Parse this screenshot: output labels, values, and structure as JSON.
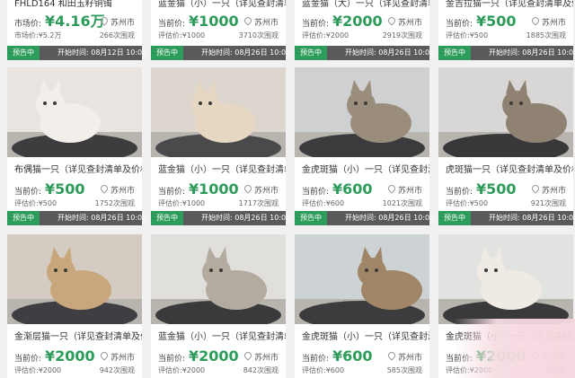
{
  "grid": {
    "top_row": [
      {
        "title": "FHLD164 和田玉籽铜镯",
        "price_label": "市场价:",
        "price": "¥4.16万",
        "location": "苏州市",
        "evaluation": "市场价:¥5.2万",
        "views": "266次围观"
      },
      {
        "title": "蓝金猫（小）一只（详见查封清单及价格通知…",
        "price_label": "当前价:",
        "price": "¥1000",
        "location": "苏州市",
        "evaluation": "评估价:¥1000",
        "views": "3710次围观",
        "status": "预告中",
        "start_time": "开始时间: 08月26日 10:00"
      },
      {
        "title": "蓝金猫（大）一只（详见查封清单及价格通知…",
        "price_label": "当前价:",
        "price": "¥2000",
        "location": "苏州市",
        "evaluation": "评估价:¥2000",
        "views": "2919次围观",
        "status": "预告中",
        "start_time": "开始时间: 08月26日 10:00"
      },
      {
        "title": "金吉拉猫一只（详见查封清单及价格通知…",
        "price_label": "当前价:",
        "price": "¥500",
        "location": "苏州市",
        "evaluation": "评估价:¥500",
        "views": "1885次围观",
        "status": "预告中",
        "start_time": "开始时间: 08月26日 10:00"
      }
    ],
    "top_first_status": {
      "status": "预告中",
      "start_time": "开始时间: 08月12日 10:00"
    },
    "middle_row": [
      {
        "title": "布偶猫一只（详见查封清单及价格通知...",
        "price_label": "当前价:",
        "price": "¥500",
        "location": "苏州市",
        "evaluation": "评估价:¥500",
        "views": "1752次围观",
        "status": "预告中",
        "start_time": "开始时间: 08月26日 10:00"
      },
      {
        "title": "蓝金猫（小）一只（详见查封清单及价格...",
        "price_label": "当前价:",
        "price": "¥1000",
        "location": "苏州市",
        "evaluation": "评估价:¥1000",
        "views": "1717次围观",
        "status": "预告中",
        "start_time": "开始时间: 08月26日 10:00"
      },
      {
        "title": "金虎斑猫（小）一只（详见查封清单及价...",
        "price_label": "当前价:",
        "price": "¥600",
        "location": "苏州市",
        "evaluation": "评估价:¥600",
        "views": "1021次围观",
        "status": "预告中",
        "start_time": "开始时间: 08月26日 10:00"
      },
      {
        "title": "虎斑猫一只（详见查封清单及价格通知...",
        "price_label": "当前价:",
        "price": "¥500",
        "location": "苏州市",
        "evaluation": "评估价:¥500",
        "views": "921次围观",
        "status": "预告中",
        "start_time": "开始时间: 08月26日 10:00"
      }
    ],
    "bottom_row": [
      {
        "title": "金渐层猫一只（详见查封清单及价格通...",
        "price_label": "当前价:",
        "price": "¥2000",
        "location": "苏州市",
        "evaluation": "评估价:¥2000",
        "views": "942次围观"
      },
      {
        "title": "蓝金猫（小）一只（详见查封清单及价...",
        "price_label": "当前价:",
        "price": "¥2000",
        "location": "苏州市",
        "evaluation": "评估价:¥2000",
        "views": "842次围观"
      },
      {
        "title": "金虎斑猫（小）一只（详见查封清单及价...",
        "price_label": "当前价:",
        "price": "¥600",
        "location": "苏州市",
        "evaluation": "评估价:¥600",
        "views": "585次围观"
      },
      {
        "title": "金虎斑猫（小）一只（详见查封清单及价...",
        "price_label": "当前价:",
        "price": "¥2000",
        "location": "苏州市",
        "evaluation": "评估价:¥2000",
        "views": "次围观"
      }
    ]
  },
  "colors": {
    "accent_green": "#2d9c5a",
    "status_bar_gray": "#5a5a5a",
    "background": "#f1f1f1"
  },
  "icons": {
    "location": "location-pin-icon"
  }
}
